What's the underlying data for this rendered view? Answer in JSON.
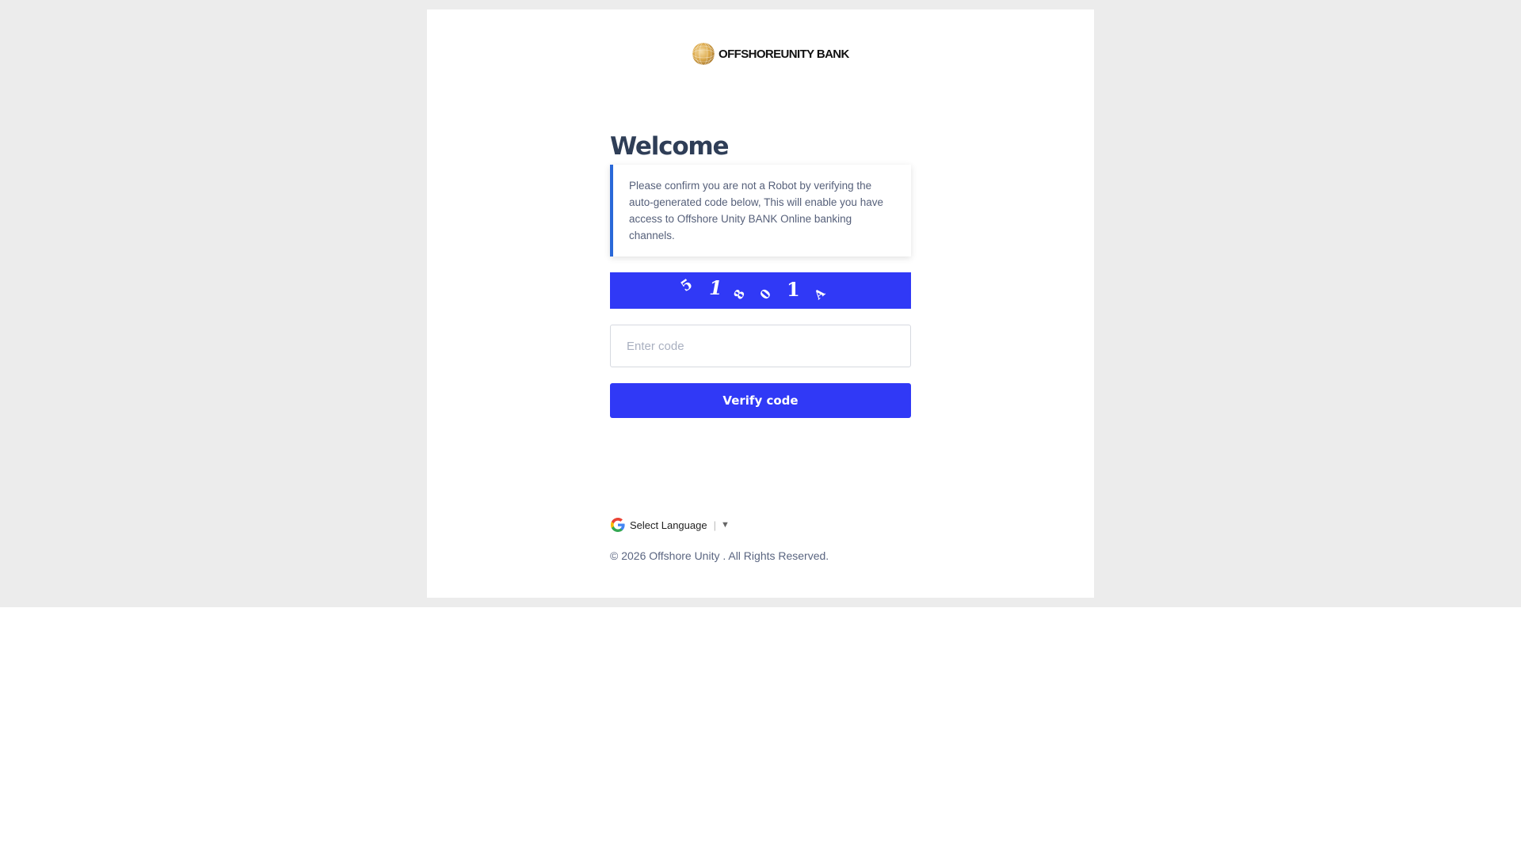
{
  "brand": {
    "name": "OFFSHOREUNITY BANK",
    "logo_icon": "golden-sphere-logo-icon",
    "accent_color": "#3039f6",
    "gold_color": "#d9a23a"
  },
  "welcome": {
    "title": "Welcome",
    "notice": "Please confirm you are not a Robot by verifying the auto-generated code below, This will enable you have access to Offshore Unity BANK Online banking channels."
  },
  "captcha": {
    "characters": [
      "5",
      "1",
      "8",
      "0",
      "1",
      "A"
    ]
  },
  "form": {
    "code_placeholder": "Enter code",
    "code_value": "",
    "verify_label": "Verify code"
  },
  "language": {
    "icon": "google-g-icon",
    "label": "Select Language",
    "separator": "|",
    "arrow": "▼"
  },
  "footer": {
    "copyright": "© 2026 Offshore Unity . All Rights Reserved."
  }
}
